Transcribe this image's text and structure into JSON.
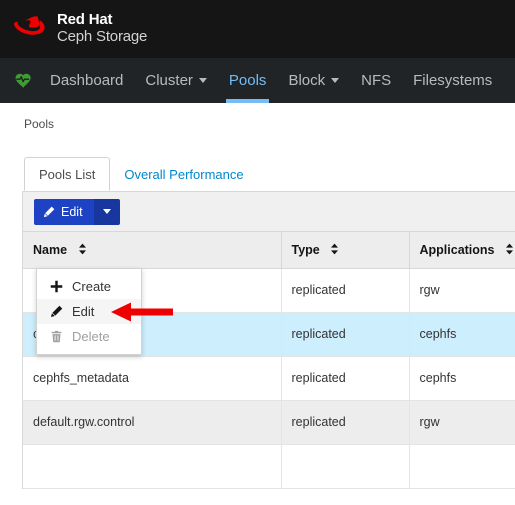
{
  "brand": {
    "logo_icon": "redhat-hat-icon",
    "line1": "Red Hat",
    "line2": "Ceph Storage"
  },
  "nav": {
    "health_icon": "heart-pulse-icon",
    "items": [
      {
        "label": "Dashboard",
        "has_caret": false,
        "active": false
      },
      {
        "label": "Cluster",
        "has_caret": true,
        "active": false
      },
      {
        "label": "Pools",
        "has_caret": false,
        "active": true
      },
      {
        "label": "Block",
        "has_caret": true,
        "active": false
      },
      {
        "label": "NFS",
        "has_caret": false,
        "active": false
      },
      {
        "label": "Filesystems",
        "has_caret": false,
        "active": false
      }
    ],
    "active_color": "#73bcf7"
  },
  "breadcrumb": {
    "text": "Pools"
  },
  "tabs": [
    {
      "label": "Pools List",
      "active": true
    },
    {
      "label": "Overall Performance",
      "active": false
    }
  ],
  "toolbar": {
    "edit_label": "Edit",
    "edit_icon": "pencil-icon",
    "dropdown_icon": "caret-down-icon",
    "button_color": "#1d43c4"
  },
  "dropdown": {
    "items": [
      {
        "label": "Create",
        "icon": "plus-icon",
        "state": "normal"
      },
      {
        "label": "Edit",
        "icon": "pencil-icon",
        "state": "hover"
      },
      {
        "label": "Delete",
        "icon": "trash-icon",
        "state": "disabled"
      }
    ]
  },
  "table": {
    "columns": [
      {
        "label": "Name",
        "sortable": true
      },
      {
        "label": "Type",
        "sortable": true
      },
      {
        "label": "Applications",
        "sortable": true
      }
    ],
    "rows": [
      {
        "name": "",
        "type": "replicated",
        "applications": "rgw",
        "style": "plain"
      },
      {
        "name": "cephfs_data",
        "type": "replicated",
        "applications": "cephfs",
        "style": "selected"
      },
      {
        "name": "cephfs_metadata",
        "type": "replicated",
        "applications": "cephfs",
        "style": "plain"
      },
      {
        "name": "default.rgw.control",
        "type": "replicated",
        "applications": "rgw",
        "style": "striped"
      },
      {
        "name": "",
        "type": "",
        "applications": "",
        "style": "plain"
      }
    ]
  },
  "annotation": {
    "arrow_icon": "red-left-arrow-icon",
    "color": "#ee0000"
  }
}
